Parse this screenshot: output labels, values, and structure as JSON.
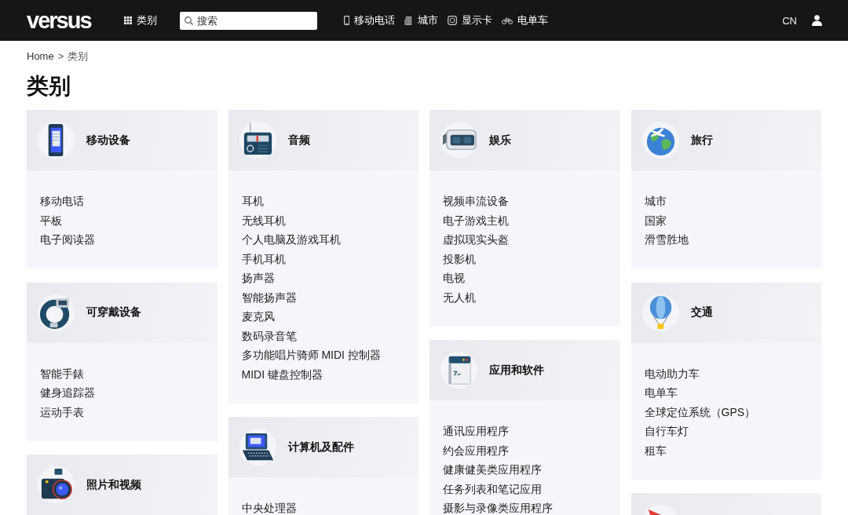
{
  "nav": {
    "logo": "versus",
    "categories_button": "类别",
    "search": {
      "placeholder": "搜索"
    },
    "links": [
      "移动电话",
      "城市",
      "显示卡",
      "电单车"
    ],
    "language": "CN"
  },
  "breadcrumb": {
    "items": [
      "Home",
      "类别"
    ],
    "separator": ">"
  },
  "title": "类别",
  "columns": [
    {
      "cards": [
        {
          "title": "移动设备",
          "items": [
            "移动电话",
            "平板",
            "电子阅读器"
          ]
        },
        {
          "title": "可穿戴设备",
          "items": [
            "智能手錶",
            "健身追踪器",
            "运动手表"
          ]
        },
        {
          "title": "照片和视频"
        }
      ]
    },
    {
      "cards": [
        {
          "title": "音频",
          "items": [
            "耳机",
            "无线耳机",
            "个人电脑及游戏耳机",
            "手机耳机",
            "扬声器",
            "智能扬声器",
            "麦克风",
            "数码录音笔",
            "多功能唱片骑师 MIDI 控制器",
            "MIDI 键盘控制器"
          ]
        },
        {
          "title": "计算机及配件",
          "items": [
            "中央处理器"
          ]
        }
      ]
    },
    {
      "cards": [
        {
          "title": "娱乐",
          "items": [
            "视频串流设备",
            "电子游戏主机",
            "虚拟现实头盔",
            "投影机",
            "电视",
            "无人机"
          ]
        },
        {
          "title": "应用和软件",
          "items": [
            "通讯应用程序",
            "约会应用程序",
            "健康健美类应用程序",
            "任务列表和笔记应用",
            "摄影与录像类应用程序"
          ]
        }
      ]
    },
    {
      "cards": [
        {
          "title": "旅行",
          "items": [
            "城市",
            "国家",
            "滑雪胜地"
          ]
        },
        {
          "title": "交通",
          "items": [
            "电动助力车",
            "电单车",
            "全球定位系统（GPS）",
            "自行车灯",
            "租车"
          ]
        },
        {
          "cut_off": true
        }
      ]
    }
  ]
}
